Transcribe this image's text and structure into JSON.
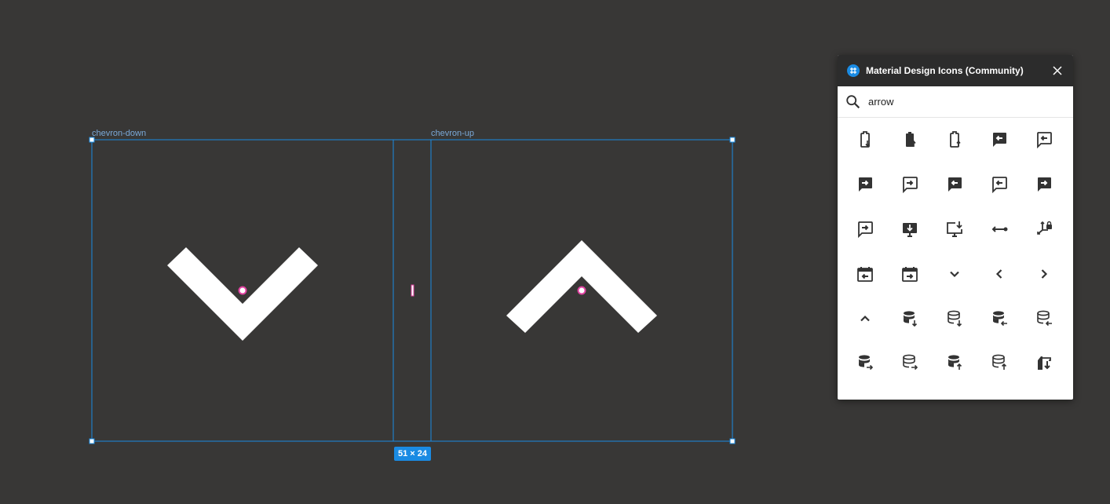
{
  "canvas": {
    "frames": [
      {
        "label": "chevron-down",
        "icon": "chevron-down-icon"
      },
      {
        "label": "chevron-up",
        "icon": "chevron-up-icon"
      }
    ],
    "selection_size": "51 × 24"
  },
  "panel": {
    "title": "Material Design Icons (Community)",
    "search": {
      "value": "arrow",
      "placeholder": "Search"
    },
    "icons": [
      "battery-arrow-down-outline-icon",
      "battery-arrow-up-icon",
      "battery-arrow-up-outline-icon",
      "comment-arrow-left-icon",
      "comment-arrow-left-outline-icon",
      "comment-arrow-right-icon",
      "comment-arrow-right-outline-icon",
      "message-arrow-left-icon",
      "message-arrow-left-outline-icon",
      "message-arrow-right-icon",
      "message-arrow-right-outline-icon",
      "monitor-arrow-down-icon",
      "monitor-arrow-down-variant-icon",
      "arrow-left-right-bold-icon",
      "axis-arrow-lock-icon",
      "calendar-arrow-left-icon",
      "calendar-arrow-right-icon",
      "chevron-down-icon",
      "chevron-left-icon",
      "chevron-right-icon",
      "chevron-up-icon",
      "database-arrow-down-icon",
      "database-arrow-down-outline-icon",
      "database-arrow-left-icon",
      "database-arrow-left-outline-icon",
      "database-arrow-right-icon",
      "database-arrow-right-outline-icon",
      "database-arrow-up-icon",
      "database-arrow-up-outline-icon",
      "crane-arrow-down-icon"
    ]
  },
  "colors": {
    "canvas_bg": "#383736",
    "selection": "#1a8be3",
    "panel_header": "#2c2c2c",
    "icon": "#333333"
  }
}
